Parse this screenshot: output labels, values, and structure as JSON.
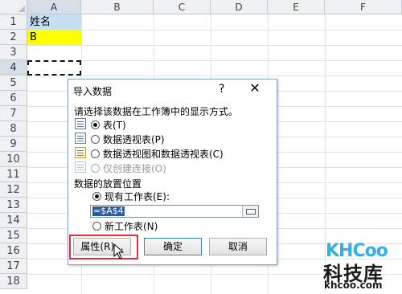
{
  "spreadsheet": {
    "columns": [
      "A",
      "B",
      "C",
      "D",
      "E",
      "F"
    ],
    "rows": [
      "1",
      "2",
      "3",
      "4",
      "5",
      "6",
      "7",
      "8",
      "9",
      "10",
      "11",
      "12",
      "13",
      "14",
      "15",
      "16",
      "17",
      "18"
    ],
    "cells": {
      "A1": "姓名",
      "A2": "B"
    },
    "colors": {
      "header_fill": "#c7dff2",
      "value_fill": "#ffff00",
      "grid": "#dfe3e8"
    }
  },
  "dialog": {
    "title": "导入数据",
    "help": "?",
    "close": "✕",
    "prompt": "请选择该数据在工作簿中的显示方式。",
    "view_options": [
      {
        "label": "表(T)",
        "selected": true,
        "enabled": true,
        "icon": "table-icon"
      },
      {
        "label": "数据透视表(P)",
        "selected": false,
        "enabled": true,
        "icon": "pivot-table-icon"
      },
      {
        "label": "数据透视图和数据透视表(C)",
        "selected": false,
        "enabled": true,
        "icon": "pivot-chart-icon"
      },
      {
        "label": "仅创建连接(O)",
        "selected": false,
        "enabled": false,
        "icon": "connection-icon"
      }
    ],
    "placement_label": "数据的放置位置",
    "placement_options": [
      {
        "label": "现有工作表(E):",
        "selected": true
      },
      {
        "label": "新工作表(N)",
        "selected": false
      }
    ],
    "range_value": "=$A$4",
    "buttons": {
      "properties": "属性(R)...",
      "ok": "确定",
      "cancel": "取消"
    },
    "accent": "#e0303a"
  },
  "watermark": {
    "brand": "KHCoo",
    "cn": "科技库",
    "url": "khcoo.com"
  }
}
